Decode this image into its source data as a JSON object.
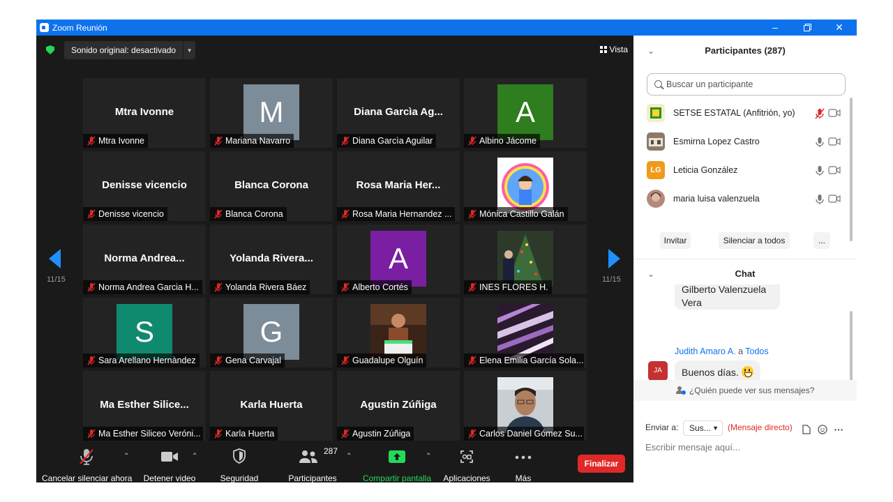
{
  "window": {
    "title": "Zoom Reunión"
  },
  "meeting": {
    "audio_label": "Sonido original: desactivado",
    "view_label": "Vista",
    "page_indicator_left": "11/15",
    "page_indicator_right": "11/15"
  },
  "tiles": [
    {
      "big": "Mtra Ivonne",
      "name": "Mtra Ivonne"
    },
    {
      "avatar_letter": "M",
      "avatar_color": "#7d8c99",
      "name": "Mariana Navarro"
    },
    {
      "big": "Diana Garcìa Ag...",
      "name": "Diana Garcìa Aguilar"
    },
    {
      "avatar_letter": "A",
      "avatar_color": "#2e7d1e",
      "name": "Albino Jácome"
    },
    {
      "big": "Denisse vicencio",
      "name": "Denisse vicencio"
    },
    {
      "big": "Blanca Corona",
      "name": "Blanca Corona"
    },
    {
      "big": "Rosa Maria Her...",
      "name": "Rosa Maria Hernandez ..."
    },
    {
      "photo": "chevron-pattern",
      "name": "Mónica Castillo Galán"
    },
    {
      "big": "Norma Andrea...",
      "name": "Norma Andrea Garcia H..."
    },
    {
      "big": "Yolanda Rivera...",
      "name": "Yolanda Rivera Báez"
    },
    {
      "avatar_letter": "A",
      "avatar_color": "#7a1fa2",
      "name": "Alberto Cortés"
    },
    {
      "photo": "christmas-tree",
      "name": "INES FLORES H."
    },
    {
      "avatar_letter": "S",
      "avatar_color": "#0f8a6e",
      "name": "Sara Arellano Hernàndez"
    },
    {
      "avatar_letter": "G",
      "avatar_color": "#7d8c99",
      "name": "Gena Carvajal"
    },
    {
      "photo": "birthday-cake",
      "name": "Guadalupe Olguín"
    },
    {
      "photo": "stripes",
      "name": "Elena Emilia García Sola..."
    },
    {
      "big": "Ma Esther Silice...",
      "name": "Ma Esther Siliceo Veróni..."
    },
    {
      "big": "Karla Huerta",
      "name": "Karla Huerta"
    },
    {
      "big": "Agustin Zúñiga",
      "name": "Agustin Zúñiga"
    },
    {
      "photo": "man-portrait",
      "name": "Carlos Daniel Gómez Su..."
    }
  ],
  "toolbar": {
    "unmute": "Cancelar silenciar ahora",
    "video": "Detener video",
    "security": "Seguridad",
    "participants": "Participantes",
    "participants_count": "287",
    "share": "Compartir pantalla",
    "apps": "Aplicaciones",
    "more": "Más",
    "end": "Finalizar"
  },
  "participants_panel": {
    "title": "Participantes (287)",
    "search_placeholder": "Buscar un participante",
    "rows": [
      {
        "name": "SETSE ESTATAL (Anfitrión, yo)",
        "initials": "",
        "muted": true
      },
      {
        "name": "Esmirna Lopez Castro",
        "initials": "",
        "muted": false
      },
      {
        "name": "Leticia González",
        "initials": "LG",
        "muted": false
      },
      {
        "name": "maria luisa valenzuela",
        "initials": "",
        "muted": false
      }
    ],
    "invite": "Invitar",
    "mute_all": "Silenciar a todos",
    "more": "..."
  },
  "chat": {
    "title": "Chat",
    "prev_message": "Gilberto Valenzuela Vera",
    "sender": "Judith Amaro A.",
    "to_word": "a",
    "recipient": "Todos",
    "avatar_initials": "JA",
    "message": "Buenos días.",
    "who_sees": "¿Quién puede ver sus mensajes?",
    "send_to_label": "Enviar a:",
    "send_to_value": "Sus...",
    "direct_label": "(Mensaje directo)",
    "input_placeholder": "Escribir mensaje aquí..."
  },
  "colors": {
    "zoom_blue": "#0e72ed",
    "end_red": "#e02828",
    "share_green": "#23d959"
  }
}
